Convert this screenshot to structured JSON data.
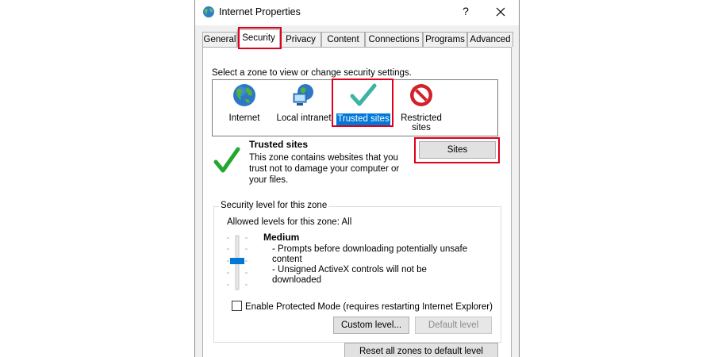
{
  "window": {
    "title": "Internet Properties",
    "help_label": "?"
  },
  "tabs": [
    {
      "label": "General"
    },
    {
      "label": "Security",
      "active": true
    },
    {
      "label": "Privacy"
    },
    {
      "label": "Content"
    },
    {
      "label": "Connections"
    },
    {
      "label": "Programs"
    },
    {
      "label": "Advanced"
    }
  ],
  "security": {
    "intro": "Select a zone to view or change security settings.",
    "zones": [
      {
        "label": "Internet",
        "icon": "globe-icon"
      },
      {
        "label": "Local intranet",
        "icon": "intranet-icon"
      },
      {
        "label": "Trusted sites",
        "icon": "checkmark-icon",
        "selected": true
      },
      {
        "label_line1": "Restricted",
        "label_line2": "sites",
        "icon": "no-entry-icon"
      }
    ],
    "zone_info": {
      "title": "Trusted sites",
      "description_lines": [
        "This zone contains websites that you",
        "trust not to damage your computer or",
        "your files."
      ],
      "sites_button": "Sites"
    },
    "level": {
      "legend": "Security level for this zone",
      "allowed": "Allowed levels for this zone: All",
      "name": "Medium",
      "details": [
        "- Prompts before downloading potentially unsafe",
        "content",
        "- Unsigned ActiveX controls will not be downloaded"
      ],
      "protected_mode_label": "Enable Protected Mode (requires restarting Internet Explorer)",
      "protected_mode_checked": false,
      "custom_button": "Custom level...",
      "default_button": "Default level"
    },
    "reset_button": "Reset all zones to default level"
  },
  "colors": {
    "highlight": "#e0001b",
    "selection": "#0078d7",
    "check_green": "#22a830",
    "teal_check": "#3cb4a0",
    "no_entry_red": "#d3202a"
  }
}
